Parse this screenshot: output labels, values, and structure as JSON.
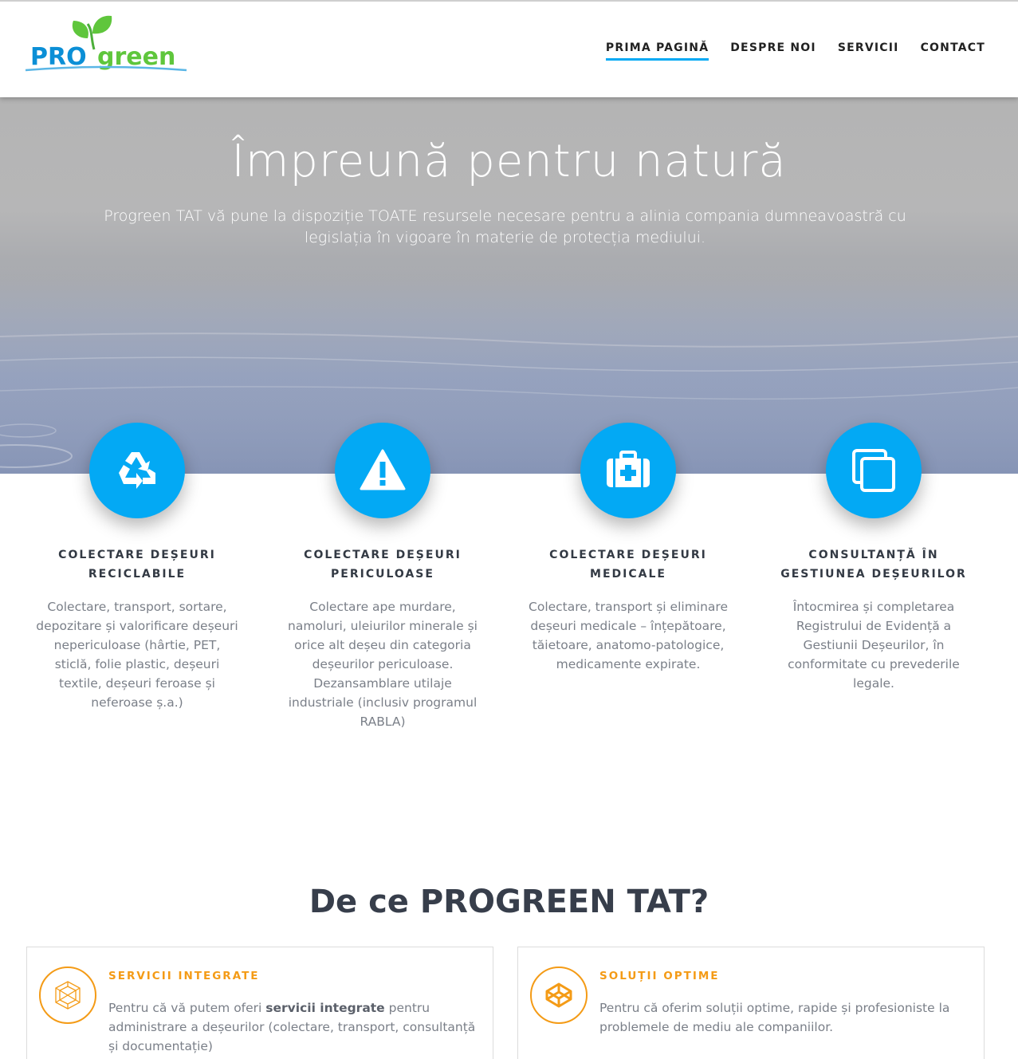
{
  "brand": {
    "logo_pro": "PRO",
    "logo_green": "green",
    "accent": "#03a9f4",
    "orange": "#f49b16",
    "leaf": "#5fc63c"
  },
  "nav": {
    "items": [
      {
        "label": "PRIMA PAGINĂ",
        "active": true
      },
      {
        "label": "DESPRE NOI"
      },
      {
        "label": "SERVICII"
      },
      {
        "label": "CONTACT"
      }
    ]
  },
  "hero": {
    "title": "Împreună pentru natură",
    "subtitle": "Progreen TAT vă pune la dispoziție TOATE resursele necesare pentru a alinia compania dumneavoastră cu legislația în vigoare în materie de protecția mediului."
  },
  "features": [
    {
      "icon": "recycle-icon",
      "title": "COLECTARE DEȘEURI RECICLABILE",
      "text": "Colectare, transport, sortare, depozitare și valorificare deșeuri nepericuloase (hârtie, PET, sticlă, folie plastic, deșeuri textile, deșeuri feroase și neferoase ș.a.)"
    },
    {
      "icon": "warning-icon",
      "title": "COLECTARE DEȘEURI PERICULOASE",
      "text": "Colectare ape murdare, namoluri, uleiurilor minerale și orice alt deșeu din categoria deșeurilor periculoase. Dezansamblare utilaje industriale (inclusiv programul RABLA)"
    },
    {
      "icon": "medkit-icon",
      "title": "COLECTARE DEȘEURI MEDICALE",
      "text": "Colectare, transport și eliminare deșeuri medicale – înțepătoare, tăietoare, anatomo-patologice, medicamente expirate."
    },
    {
      "icon": "copy-icon",
      "title": "CONSULTANȚĂ ÎN GESTIUNEA DEȘEURILOR",
      "text": "Întocmirea și completarea Registrului de Evidență a Gestiunii Deșeurilor, în conformitate cu prevederile legale."
    }
  ],
  "why": {
    "title": "De ce PROGREEN TAT?",
    "cards": [
      {
        "icon": "polyhedron-icon",
        "title": "SERVICII INTEGRATE",
        "text_before": "Pentru că vă putem oferi ",
        "text_bold": "servicii integrate",
        "text_after": " pentru administrare a deșeurilor (colectare, transport, consultanță și documentație)"
      },
      {
        "icon": "codepen-cube-icon",
        "title": "SOLUȚII OPTIME",
        "text": "Pentru că oferim soluții optime, rapide și profesioniste la problemele de mediu ale companiilor."
      }
    ]
  }
}
